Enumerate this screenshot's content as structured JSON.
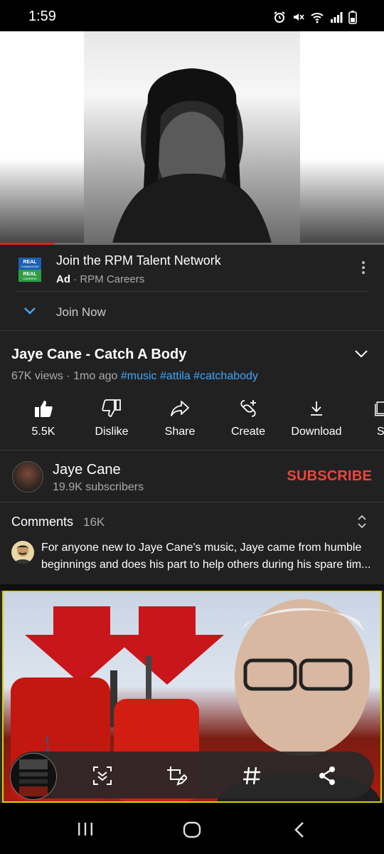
{
  "status_bar": {
    "time": "1:59"
  },
  "player": {
    "progress_fraction": 0.14
  },
  "ad": {
    "logo_text_top": "REAL",
    "logo_text_sub": "COMMUNITIES",
    "logo_text_bottom": "REAL",
    "logo_text_bottom_sub": "CAREERS",
    "title": "Join the RPM Talent Network",
    "badge": "Ad",
    "separator": "·",
    "advertiser": "RPM Careers",
    "cta": "Join Now"
  },
  "video": {
    "title": "Jaye Cane - Catch A Body",
    "views": "67K views",
    "separator": "·",
    "age": "1mo ago",
    "tags": [
      "#music",
      "#attila",
      "#catchabody"
    ]
  },
  "actions": [
    {
      "label": "5.5K",
      "icon": "thumbs-up-icon"
    },
    {
      "label": "Dislike",
      "icon": "thumbs-down-icon"
    },
    {
      "label": "Share",
      "icon": "share-arrow-icon"
    },
    {
      "label": "Create",
      "icon": "create-remix-icon"
    },
    {
      "label": "Download",
      "icon": "download-icon"
    },
    {
      "label": "Sa",
      "icon": "save-playlist-icon"
    }
  ],
  "channel": {
    "name": "Jaye Cane",
    "subscribers": "19.9K subscribers",
    "subscribe_label": "SUBSCRIBE"
  },
  "comments": {
    "heading": "Comments",
    "count": "16K",
    "top_comment": "For anyone new to Jaye Cane's music, Jaye came from humble beginnings and does his part to help others during his spare tim..."
  },
  "colors": {
    "background": "#212121",
    "subscribe": "#f2433a",
    "hashtag": "#3ea6ff",
    "progress": "#e62117",
    "ad_logo_blue": "#1a5fb4",
    "ad_logo_green": "#2e9e44"
  }
}
